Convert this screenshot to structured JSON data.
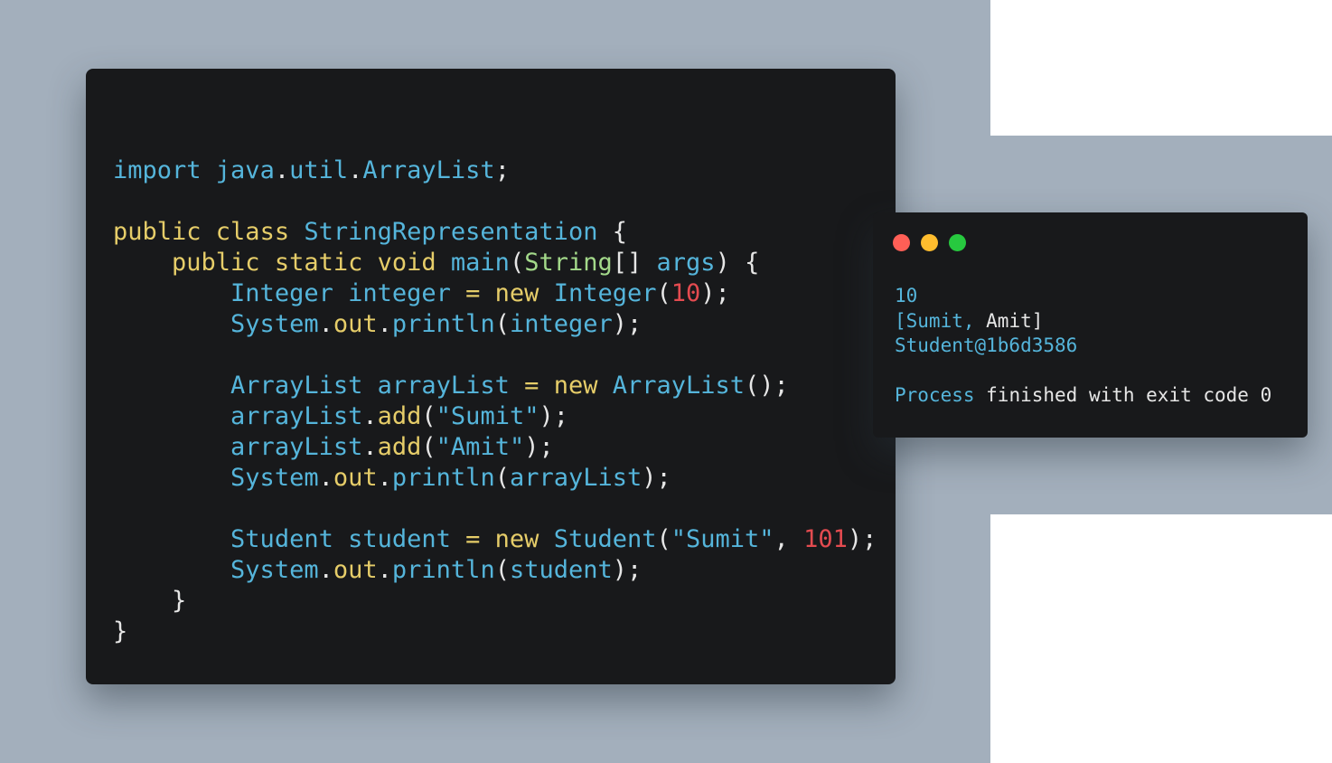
{
  "code_window": {
    "lines": [
      [
        {
          "t": "import ",
          "c": "t"
        },
        {
          "t": "java",
          "c": "t"
        },
        {
          "t": ".",
          "c": "p"
        },
        {
          "t": "util",
          "c": "t"
        },
        {
          "t": ".",
          "c": "p"
        },
        {
          "t": "ArrayList",
          "c": "t"
        },
        {
          "t": ";",
          "c": "p"
        }
      ],
      [],
      [
        {
          "t": "public ",
          "c": "k"
        },
        {
          "t": "class ",
          "c": "k"
        },
        {
          "t": "StringRepresentation",
          "c": "t"
        },
        {
          "t": " {",
          "c": "p"
        }
      ],
      [
        {
          "t": "    ",
          "c": "p"
        },
        {
          "t": "public ",
          "c": "k"
        },
        {
          "t": "static ",
          "c": "k"
        },
        {
          "t": "void ",
          "c": "k"
        },
        {
          "t": "main",
          "c": "t"
        },
        {
          "t": "(",
          "c": "p"
        },
        {
          "t": "String",
          "c": "m"
        },
        {
          "t": "[] ",
          "c": "p"
        },
        {
          "t": "args",
          "c": "t"
        },
        {
          "t": ") {",
          "c": "p"
        }
      ],
      [
        {
          "t": "        ",
          "c": "p"
        },
        {
          "t": "Integer ",
          "c": "t"
        },
        {
          "t": "integer ",
          "c": "t"
        },
        {
          "t": "= ",
          "c": "k"
        },
        {
          "t": "new ",
          "c": "k"
        },
        {
          "t": "Integer",
          "c": "t"
        },
        {
          "t": "(",
          "c": "p"
        },
        {
          "t": "10",
          "c": "n"
        },
        {
          "t": ");",
          "c": "p"
        }
      ],
      [
        {
          "t": "        ",
          "c": "p"
        },
        {
          "t": "System",
          "c": "t"
        },
        {
          "t": ".",
          "c": "p"
        },
        {
          "t": "out",
          "c": "k"
        },
        {
          "t": ".",
          "c": "p"
        },
        {
          "t": "println",
          "c": "t"
        },
        {
          "t": "(",
          "c": "p"
        },
        {
          "t": "integer",
          "c": "t"
        },
        {
          "t": ");",
          "c": "p"
        }
      ],
      [],
      [
        {
          "t": "        ",
          "c": "p"
        },
        {
          "t": "ArrayList ",
          "c": "t"
        },
        {
          "t": "arrayList ",
          "c": "t"
        },
        {
          "t": "= ",
          "c": "k"
        },
        {
          "t": "new ",
          "c": "k"
        },
        {
          "t": "ArrayList",
          "c": "t"
        },
        {
          "t": "();",
          "c": "p"
        }
      ],
      [
        {
          "t": "        ",
          "c": "p"
        },
        {
          "t": "arrayList",
          "c": "t"
        },
        {
          "t": ".",
          "c": "p"
        },
        {
          "t": "add",
          "c": "k"
        },
        {
          "t": "(",
          "c": "p"
        },
        {
          "t": "\"Sumit\"",
          "c": "s"
        },
        {
          "t": ");",
          "c": "p"
        }
      ],
      [
        {
          "t": "        ",
          "c": "p"
        },
        {
          "t": "arrayList",
          "c": "t"
        },
        {
          "t": ".",
          "c": "p"
        },
        {
          "t": "add",
          "c": "k"
        },
        {
          "t": "(",
          "c": "p"
        },
        {
          "t": "\"Amit\"",
          "c": "s"
        },
        {
          "t": ");",
          "c": "p"
        }
      ],
      [
        {
          "t": "        ",
          "c": "p"
        },
        {
          "t": "System",
          "c": "t"
        },
        {
          "t": ".",
          "c": "p"
        },
        {
          "t": "out",
          "c": "k"
        },
        {
          "t": ".",
          "c": "p"
        },
        {
          "t": "println",
          "c": "t"
        },
        {
          "t": "(",
          "c": "p"
        },
        {
          "t": "arrayList",
          "c": "t"
        },
        {
          "t": ");",
          "c": "p"
        }
      ],
      [],
      [
        {
          "t": "        ",
          "c": "p"
        },
        {
          "t": "Student ",
          "c": "t"
        },
        {
          "t": "student ",
          "c": "t"
        },
        {
          "t": "= ",
          "c": "k"
        },
        {
          "t": "new ",
          "c": "k"
        },
        {
          "t": "Student",
          "c": "t"
        },
        {
          "t": "(",
          "c": "p"
        },
        {
          "t": "\"Sumit\"",
          "c": "s"
        },
        {
          "t": ", ",
          "c": "p"
        },
        {
          "t": "101",
          "c": "n"
        },
        {
          "t": ");",
          "c": "p"
        }
      ],
      [
        {
          "t": "        ",
          "c": "p"
        },
        {
          "t": "System",
          "c": "t"
        },
        {
          "t": ".",
          "c": "p"
        },
        {
          "t": "out",
          "c": "k"
        },
        {
          "t": ".",
          "c": "p"
        },
        {
          "t": "println",
          "c": "t"
        },
        {
          "t": "(",
          "c": "p"
        },
        {
          "t": "student",
          "c": "t"
        },
        {
          "t": ");",
          "c": "p"
        }
      ],
      [
        {
          "t": "    }",
          "c": "p"
        }
      ],
      [
        {
          "t": "}",
          "c": "p"
        }
      ]
    ]
  },
  "output_window": {
    "lines": [
      [
        {
          "t": "10",
          "c": "t"
        }
      ],
      [
        {
          "t": "[Sumit, ",
          "c": "t"
        },
        {
          "t": "Amit]",
          "c": "w"
        }
      ],
      [
        {
          "t": "Student@1b6d3586",
          "c": "t"
        }
      ],
      [],
      [
        {
          "t": "Process ",
          "c": "t"
        },
        {
          "t": "finished with exit code 0",
          "c": "w"
        }
      ]
    ]
  },
  "colors": {
    "window_bg": "#18191b",
    "page_bg": "#a3afbc",
    "close": "#ff5f56",
    "minimize": "#ffbd2e",
    "maximize": "#27c93f"
  }
}
